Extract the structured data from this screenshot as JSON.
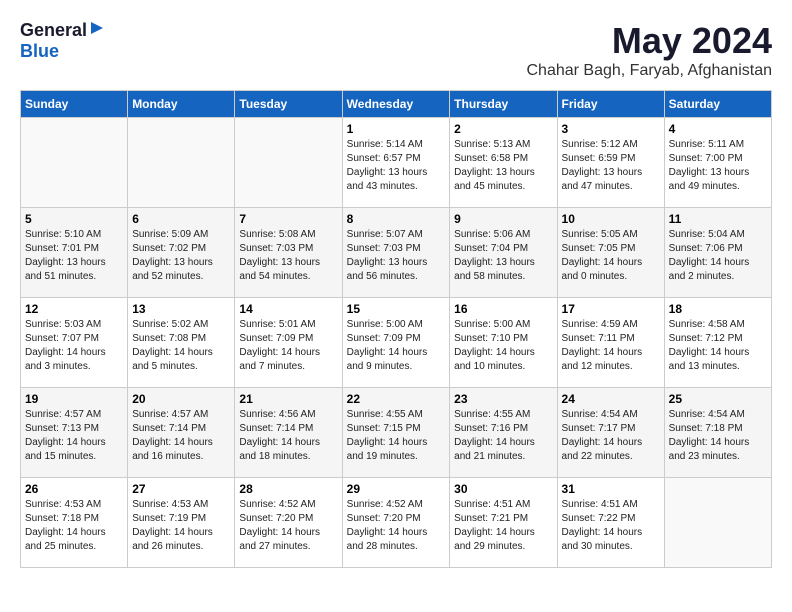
{
  "header": {
    "logo_general": "General",
    "logo_blue": "Blue",
    "month_title": "May 2024",
    "location": "Chahar Bagh, Faryab, Afghanistan"
  },
  "weekdays": [
    "Sunday",
    "Monday",
    "Tuesday",
    "Wednesday",
    "Thursday",
    "Friday",
    "Saturday"
  ],
  "weeks": [
    [
      {
        "day": "",
        "info": ""
      },
      {
        "day": "",
        "info": ""
      },
      {
        "day": "",
        "info": ""
      },
      {
        "day": "1",
        "info": "Sunrise: 5:14 AM\nSunset: 6:57 PM\nDaylight: 13 hours\nand 43 minutes."
      },
      {
        "day": "2",
        "info": "Sunrise: 5:13 AM\nSunset: 6:58 PM\nDaylight: 13 hours\nand 45 minutes."
      },
      {
        "day": "3",
        "info": "Sunrise: 5:12 AM\nSunset: 6:59 PM\nDaylight: 13 hours\nand 47 minutes."
      },
      {
        "day": "4",
        "info": "Sunrise: 5:11 AM\nSunset: 7:00 PM\nDaylight: 13 hours\nand 49 minutes."
      }
    ],
    [
      {
        "day": "5",
        "info": "Sunrise: 5:10 AM\nSunset: 7:01 PM\nDaylight: 13 hours\nand 51 minutes."
      },
      {
        "day": "6",
        "info": "Sunrise: 5:09 AM\nSunset: 7:02 PM\nDaylight: 13 hours\nand 52 minutes."
      },
      {
        "day": "7",
        "info": "Sunrise: 5:08 AM\nSunset: 7:03 PM\nDaylight: 13 hours\nand 54 minutes."
      },
      {
        "day": "8",
        "info": "Sunrise: 5:07 AM\nSunset: 7:03 PM\nDaylight: 13 hours\nand 56 minutes."
      },
      {
        "day": "9",
        "info": "Sunrise: 5:06 AM\nSunset: 7:04 PM\nDaylight: 13 hours\nand 58 minutes."
      },
      {
        "day": "10",
        "info": "Sunrise: 5:05 AM\nSunset: 7:05 PM\nDaylight: 14 hours\nand 0 minutes."
      },
      {
        "day": "11",
        "info": "Sunrise: 5:04 AM\nSunset: 7:06 PM\nDaylight: 14 hours\nand 2 minutes."
      }
    ],
    [
      {
        "day": "12",
        "info": "Sunrise: 5:03 AM\nSunset: 7:07 PM\nDaylight: 14 hours\nand 3 minutes."
      },
      {
        "day": "13",
        "info": "Sunrise: 5:02 AM\nSunset: 7:08 PM\nDaylight: 14 hours\nand 5 minutes."
      },
      {
        "day": "14",
        "info": "Sunrise: 5:01 AM\nSunset: 7:09 PM\nDaylight: 14 hours\nand 7 minutes."
      },
      {
        "day": "15",
        "info": "Sunrise: 5:00 AM\nSunset: 7:09 PM\nDaylight: 14 hours\nand 9 minutes."
      },
      {
        "day": "16",
        "info": "Sunrise: 5:00 AM\nSunset: 7:10 PM\nDaylight: 14 hours\nand 10 minutes."
      },
      {
        "day": "17",
        "info": "Sunrise: 4:59 AM\nSunset: 7:11 PM\nDaylight: 14 hours\nand 12 minutes."
      },
      {
        "day": "18",
        "info": "Sunrise: 4:58 AM\nSunset: 7:12 PM\nDaylight: 14 hours\nand 13 minutes."
      }
    ],
    [
      {
        "day": "19",
        "info": "Sunrise: 4:57 AM\nSunset: 7:13 PM\nDaylight: 14 hours\nand 15 minutes."
      },
      {
        "day": "20",
        "info": "Sunrise: 4:57 AM\nSunset: 7:14 PM\nDaylight: 14 hours\nand 16 minutes."
      },
      {
        "day": "21",
        "info": "Sunrise: 4:56 AM\nSunset: 7:14 PM\nDaylight: 14 hours\nand 18 minutes."
      },
      {
        "day": "22",
        "info": "Sunrise: 4:55 AM\nSunset: 7:15 PM\nDaylight: 14 hours\nand 19 minutes."
      },
      {
        "day": "23",
        "info": "Sunrise: 4:55 AM\nSunset: 7:16 PM\nDaylight: 14 hours\nand 21 minutes."
      },
      {
        "day": "24",
        "info": "Sunrise: 4:54 AM\nSunset: 7:17 PM\nDaylight: 14 hours\nand 22 minutes."
      },
      {
        "day": "25",
        "info": "Sunrise: 4:54 AM\nSunset: 7:18 PM\nDaylight: 14 hours\nand 23 minutes."
      }
    ],
    [
      {
        "day": "26",
        "info": "Sunrise: 4:53 AM\nSunset: 7:18 PM\nDaylight: 14 hours\nand 25 minutes."
      },
      {
        "day": "27",
        "info": "Sunrise: 4:53 AM\nSunset: 7:19 PM\nDaylight: 14 hours\nand 26 minutes."
      },
      {
        "day": "28",
        "info": "Sunrise: 4:52 AM\nSunset: 7:20 PM\nDaylight: 14 hours\nand 27 minutes."
      },
      {
        "day": "29",
        "info": "Sunrise: 4:52 AM\nSunset: 7:20 PM\nDaylight: 14 hours\nand 28 minutes."
      },
      {
        "day": "30",
        "info": "Sunrise: 4:51 AM\nSunset: 7:21 PM\nDaylight: 14 hours\nand 29 minutes."
      },
      {
        "day": "31",
        "info": "Sunrise: 4:51 AM\nSunset: 7:22 PM\nDaylight: 14 hours\nand 30 minutes."
      },
      {
        "day": "",
        "info": ""
      }
    ]
  ]
}
